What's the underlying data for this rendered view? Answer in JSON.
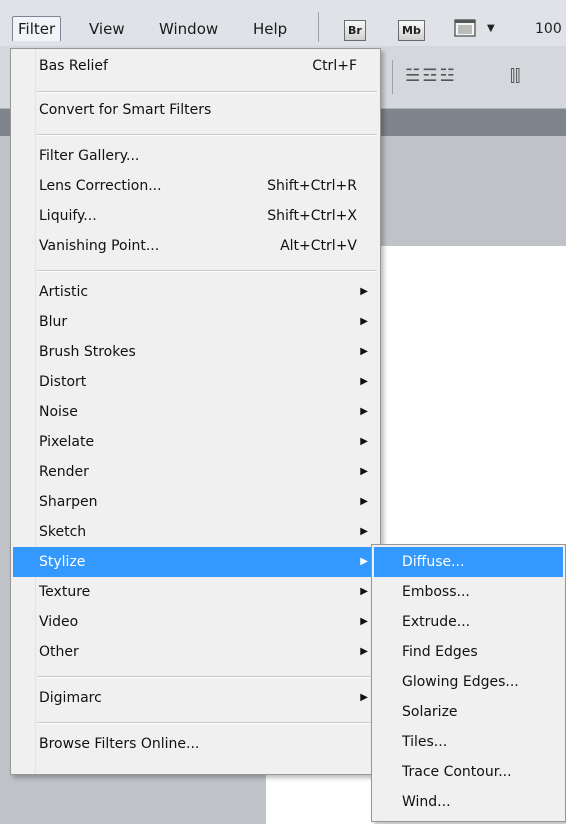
{
  "menubar": {
    "items": [
      {
        "label": "Filter"
      },
      {
        "label": "View"
      },
      {
        "label": "Window"
      },
      {
        "label": "Help"
      }
    ],
    "br_badge": "Br",
    "mb_badge": "Mb",
    "zoom": "100"
  },
  "options": {
    "align_glyphs": "☱☲☳",
    "distribute_glyphs": "⫿⫿"
  },
  "filter_menu": {
    "last_filter": {
      "label": "Bas Relief",
      "shortcut": "Ctrl+F"
    },
    "convert": {
      "label": "Convert for Smart Filters"
    },
    "tools": [
      {
        "label": "Filter Gallery...",
        "shortcut": ""
      },
      {
        "label": "Lens Correction...",
        "shortcut": "Shift+Ctrl+R"
      },
      {
        "label": "Liquify...",
        "shortcut": "Shift+Ctrl+X"
      },
      {
        "label": "Vanishing Point...",
        "shortcut": "Alt+Ctrl+V"
      }
    ],
    "categories": [
      {
        "label": "Artistic"
      },
      {
        "label": "Blur"
      },
      {
        "label": "Brush Strokes"
      },
      {
        "label": "Distort"
      },
      {
        "label": "Noise"
      },
      {
        "label": "Pixelate"
      },
      {
        "label": "Render"
      },
      {
        "label": "Sharpen"
      },
      {
        "label": "Sketch"
      },
      {
        "label": "Stylize"
      },
      {
        "label": "Texture"
      },
      {
        "label": "Video"
      },
      {
        "label": "Other"
      }
    ],
    "digimarc": {
      "label": "Digimarc"
    },
    "browse": {
      "label": "Browse Filters Online..."
    },
    "arrow_glyph": "▶"
  },
  "stylize_submenu": {
    "items": [
      {
        "label": "Diffuse..."
      },
      {
        "label": "Emboss..."
      },
      {
        "label": "Extrude..."
      },
      {
        "label": "Find Edges"
      },
      {
        "label": "Glowing Edges..."
      },
      {
        "label": "Solarize"
      },
      {
        "label": "Tiles..."
      },
      {
        "label": "Trace Contour..."
      },
      {
        "label": "Wind..."
      }
    ]
  },
  "colors": {
    "highlight": "#3399ff",
    "menu_bg": "#f0f0f0",
    "menubar_bg": "#dfe3e8"
  }
}
